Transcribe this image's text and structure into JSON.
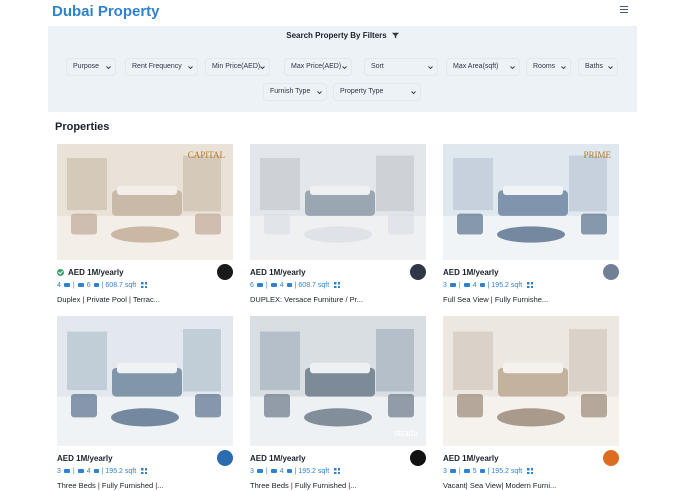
{
  "brand": "Dubai Property",
  "filters": {
    "title": "Search Property By Filters",
    "row1": [
      "Purpose",
      "Rent Frequency",
      "Min Price(AED)",
      "Max Price(AED)",
      "Sort",
      "Max Area(sqft)",
      "Rooms",
      "Baths"
    ],
    "row2": [
      "Furnish Type",
      "Property Type"
    ]
  },
  "section_title": "Properties",
  "properties": [
    {
      "price": "AED 1M/yearly",
      "verified": true,
      "rooms": "4",
      "baths": "6",
      "area": "608.7 sqft",
      "title": "Duplex | Private Pool | Terrac...",
      "photo_logo": "CAPITAL",
      "agency_color": "#1a1a1a"
    },
    {
      "price": "AED 1M/yearly",
      "verified": false,
      "rooms": "6",
      "baths": "4",
      "area": "608.7 sqft",
      "title": "DUPLEX: Versace Furniture / Pr...",
      "photo_logo": "",
      "agency_color": "#2d3748"
    },
    {
      "price": "AED 1M/yearly",
      "verified": false,
      "rooms": "3",
      "baths": "4",
      "area": "195.2 sqft",
      "title": "Full Sea View | Fully Furnishe...",
      "photo_logo": "PRIME",
      "agency_color": "#718096"
    },
    {
      "price": "AED 1M/yearly",
      "verified": false,
      "rooms": "3",
      "baths": "4",
      "area": "195.2 sqft",
      "title": "Three Beds | Fully Furnished |...",
      "photo_logo": "",
      "agency_color": "#2b6cb0"
    },
    {
      "price": "AED 1M/yearly",
      "verified": false,
      "rooms": "3",
      "baths": "4",
      "area": "195.2 sqft",
      "title": "Three Beds | Fully Furnished |...",
      "photo_logo": "strada",
      "agency_color": "#111111"
    },
    {
      "price": "AED 1M/yearly",
      "verified": false,
      "rooms": "3",
      "baths": "5",
      "area": "195.2 sqft",
      "title": "Vacant| Sea View| Modern Furni...",
      "photo_logo": "",
      "agency_color": "#dd6b20"
    }
  ],
  "colors": {
    "accent": "#3182ce",
    "panel": "#edf2f7"
  }
}
